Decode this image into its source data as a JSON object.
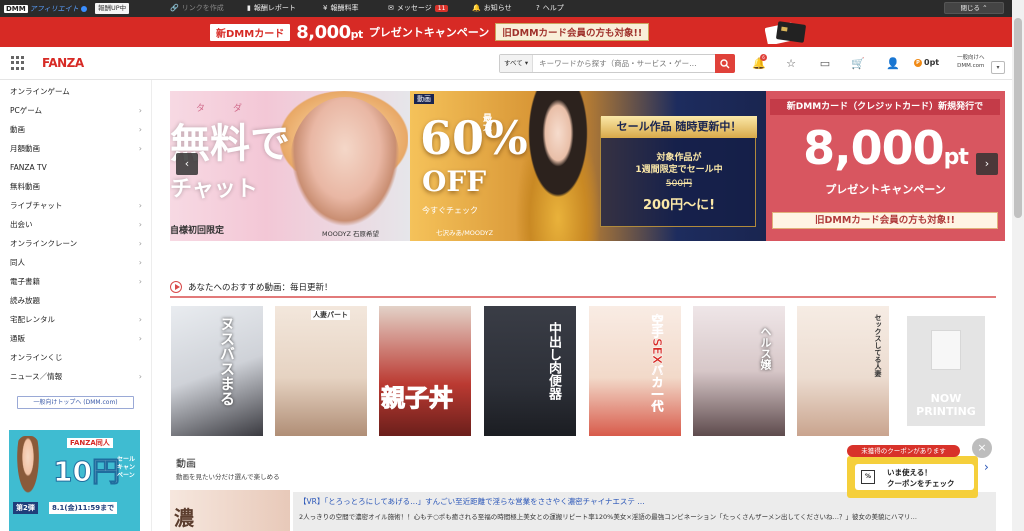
{
  "affbar": {
    "logo_dmm": "DMM",
    "logo_aff": "アフィリエイト",
    "badge": "報酬UP中",
    "link_create": "リンクを作成",
    "report": "報酬レポート",
    "rate": "報酬料率",
    "message": "メッセージ",
    "message_count": "11",
    "notice": "お知らせ",
    "help": "ヘルプ",
    "close": "閉じる"
  },
  "promo": {
    "card": "新DMMカード",
    "amount": "8,000",
    "unit": "pt",
    "text": "プレゼントキャンペーン",
    "old": "旧DMMカード会員の方も対象!!"
  },
  "header": {
    "logo": "FANZA",
    "search_scope": "すべて",
    "search_placeholder": "キーワードから探す（商品・サービス・ゲー…",
    "notif_count": "6",
    "points": "0pt",
    "general_line1": "一般向けへ",
    "general_line2": "DMM.com"
  },
  "sidebar": {
    "items": [
      {
        "label": "オンラインゲーム",
        "chev": ""
      },
      {
        "label": "PCゲーム",
        "chev": "›"
      },
      {
        "label": "動画",
        "chev": "›"
      },
      {
        "label": "月額動画",
        "chev": "›"
      },
      {
        "label": "FANZA TV",
        "chev": ""
      },
      {
        "label": "無料動画",
        "chev": ""
      },
      {
        "label": "ライブチャット",
        "chev": "›"
      },
      {
        "label": "出会い",
        "chev": "›"
      },
      {
        "label": "オンラインクレーン",
        "chev": "›"
      },
      {
        "label": "同人",
        "chev": "›"
      },
      {
        "label": "電子書籍",
        "chev": "›"
      },
      {
        "label": "読み放題",
        "chev": ""
      },
      {
        "label": "宅配レンタル",
        "chev": "›"
      },
      {
        "label": "通販",
        "chev": "›"
      },
      {
        "label": "オンラインくじ",
        "chev": ""
      },
      {
        "label": "ニュース／情報",
        "chev": "›"
      }
    ],
    "general_button": "一般向けトップへ (DMM.com)",
    "banner_label": "FANZA同人",
    "banner_big": "10円",
    "banner_sub": "セール キャンペーン",
    "banner_round": "第2弾",
    "banner_date": "8.1(金)11:59まで"
  },
  "hero": {
    "slide1": {
      "ruby": "タダ",
      "big": "無料で",
      "mid": "チャット",
      "bottom": "自様初回限定",
      "credit": "MOODYZ 石原希望"
    },
    "slide2": {
      "tag": "動画",
      "big": "60%",
      "max": "最大",
      "off": "OFF",
      "check": "今すぐチェック",
      "credit": "七沢みあ/MOODYZ",
      "box_title": "セール作品 随時更新中！",
      "box_line1": "対象作品が",
      "box_line1b": "1週間限定でセール中",
      "box_old": "500円",
      "box_new": "200円〜に!"
    },
    "slide3": {
      "head": "新DMMカード（クレジットカード）新規発行で",
      "big": "8,000",
      "unit": "pt",
      "sub": "プレゼントキャンペーン",
      "old": "旧DMMカード会員の方も対象!!"
    },
    "prev": "‹",
    "next": "›"
  },
  "recommend": {
    "title": "あなたへのおすすめ動画：毎日更新！",
    "now_printing": "NOW PRINTING",
    "items": [
      {
        "title": "ヌスバスまる",
        "color": "#cfd2d8"
      },
      {
        "title": "人妻パート",
        "color": "#e6d3c2"
      },
      {
        "title": "親子丼",
        "color": "#bb3a32"
      },
      {
        "title": "中出し肉便器",
        "color": "#2d3038"
      },
      {
        "title": "空手SEXバカ一代",
        "color": "#f2d9c9"
      },
      {
        "title": "ヘルス嬢",
        "color": "#d7c7c8"
      },
      {
        "title": "セックスしてる人妻",
        "color": "#ecdcd0"
      }
    ]
  },
  "video": {
    "title": "動画",
    "subtitle": "動画を見たい分だけ選んで楽しめる",
    "thumb_kanji": "濃",
    "link": "【VR】「とろっとろにしてあげる…」すんごい至近距離で淫らな営業をささやく濃密チャイナエステ …",
    "desc": "2人っきりの空間で濃密オイル施術！！心もチ○ポも癒される至福の時間極上美女との運搬リピート率120%美女×淫語の最強コンビネーション「たっくさんザーメン出してくださいね…？」彼女の美貌にハマリ…",
    "next": "›"
  },
  "coupon": {
    "tab": "未獲得のクーポンがあります",
    "icon": "%",
    "line1": "いま使える！",
    "line2": "クーポンをチェック",
    "close": "×"
  }
}
